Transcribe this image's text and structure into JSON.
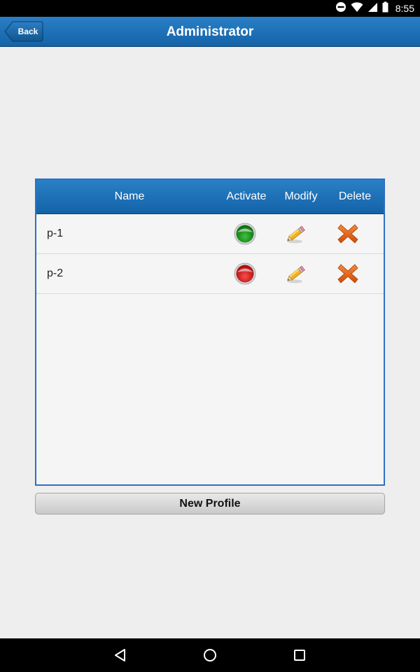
{
  "status_bar": {
    "time": "8:55",
    "icons": [
      "do-not-disturb-icon",
      "wifi-icon",
      "signal-icon",
      "battery-icon"
    ]
  },
  "header": {
    "back_label": "Back",
    "title": "Administrator"
  },
  "table": {
    "columns": [
      "Name",
      "Activate",
      "Modify",
      "Delete"
    ],
    "rows": [
      {
        "name": "p-1",
        "active": true,
        "activate_icon": "green-status-icon",
        "modify_icon": "pencil-icon",
        "delete_icon": "x-icon"
      },
      {
        "name": "p-2",
        "active": false,
        "activate_icon": "red-status-icon",
        "modify_icon": "pencil-icon",
        "delete_icon": "x-icon"
      }
    ]
  },
  "actions": {
    "new_profile_label": "New Profile"
  },
  "nav_bar": {
    "icons": [
      "nav-back-icon",
      "nav-home-icon",
      "nav-recents-icon"
    ]
  },
  "colors": {
    "header_blue": "#1463a8",
    "panel_border": "#2e6fc4",
    "active_green": "#2d9a2d",
    "inactive_red": "#d62020",
    "delete_orange": "#e06010"
  }
}
